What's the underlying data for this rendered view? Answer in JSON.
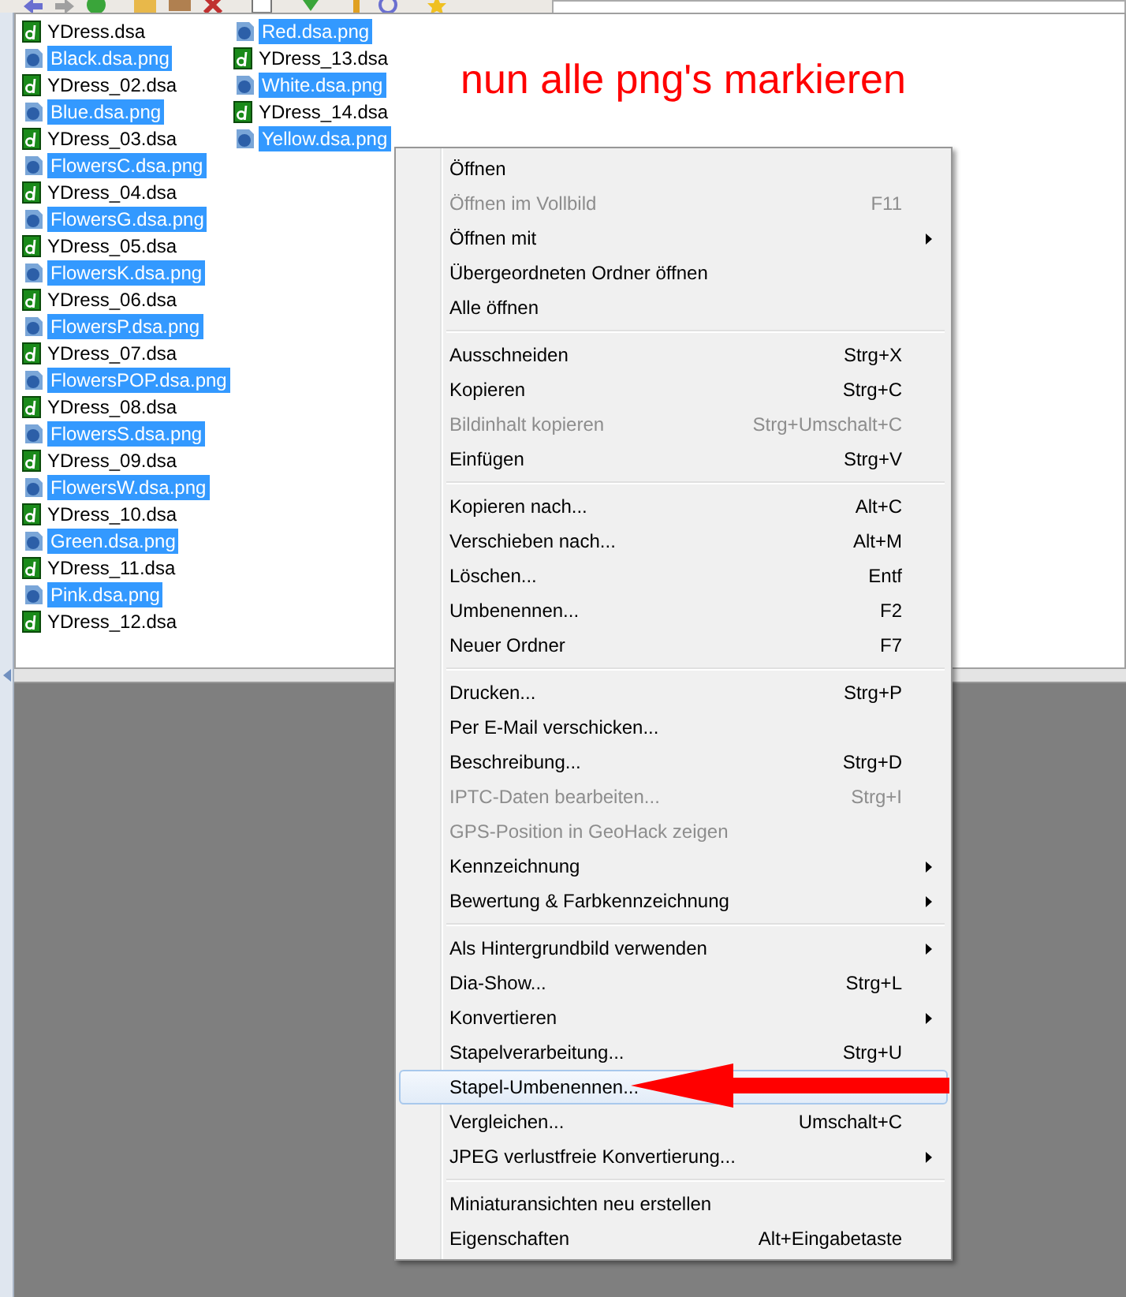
{
  "files": [
    {
      "name": "YDress.dsa",
      "kind": "dsa",
      "selected": false
    },
    {
      "name": "Black.dsa.png",
      "kind": "png",
      "selected": true
    },
    {
      "name": "YDress_02.dsa",
      "kind": "dsa",
      "selected": false
    },
    {
      "name": "Blue.dsa.png",
      "kind": "png",
      "selected": true
    },
    {
      "name": "YDress_03.dsa",
      "kind": "dsa",
      "selected": false
    },
    {
      "name": "FlowersC.dsa.png",
      "kind": "png",
      "selected": true
    },
    {
      "name": "YDress_04.dsa",
      "kind": "dsa",
      "selected": false
    },
    {
      "name": "FlowersG.dsa.png",
      "kind": "png",
      "selected": true
    },
    {
      "name": "YDress_05.dsa",
      "kind": "dsa",
      "selected": false
    },
    {
      "name": "FlowersK.dsa.png",
      "kind": "png",
      "selected": true
    },
    {
      "name": "YDress_06.dsa",
      "kind": "dsa",
      "selected": false
    },
    {
      "name": "FlowersP.dsa.png",
      "kind": "png",
      "selected": true
    },
    {
      "name": "YDress_07.dsa",
      "kind": "dsa",
      "selected": false
    },
    {
      "name": "FlowersPOP.dsa.png",
      "kind": "png",
      "selected": true
    },
    {
      "name": "YDress_08.dsa",
      "kind": "dsa",
      "selected": false
    },
    {
      "name": "FlowersS.dsa.png",
      "kind": "png",
      "selected": true
    },
    {
      "name": "YDress_09.dsa",
      "kind": "dsa",
      "selected": false
    },
    {
      "name": "FlowersW.dsa.png",
      "kind": "png",
      "selected": true
    },
    {
      "name": "YDress_10.dsa",
      "kind": "dsa",
      "selected": false
    },
    {
      "name": "Green.dsa.png",
      "kind": "png",
      "selected": true
    },
    {
      "name": "YDress_11.dsa",
      "kind": "dsa",
      "selected": false
    },
    {
      "name": "Pink.dsa.png",
      "kind": "png",
      "selected": true
    },
    {
      "name": "YDress_12.dsa",
      "kind": "dsa",
      "selected": false
    },
    {
      "name": "Red.dsa.png",
      "kind": "png",
      "selected": true
    },
    {
      "name": "YDress_13.dsa",
      "kind": "dsa",
      "selected": false
    },
    {
      "name": "White.dsa.png",
      "kind": "png",
      "selected": true
    },
    {
      "name": "YDress_14.dsa",
      "kind": "dsa",
      "selected": false
    },
    {
      "name": "Yellow.dsa.png",
      "kind": "png",
      "selected": true
    }
  ],
  "annotation": "nun alle png's markieren",
  "context_menu": {
    "groups": [
      [
        {
          "label": "Öffnen",
          "disabled": false,
          "submenu": false,
          "selected": false
        },
        {
          "label": "Öffnen im Vollbild",
          "shortcut": "F11",
          "disabled": true,
          "submenu": false,
          "selected": false
        },
        {
          "label": "Öffnen mit",
          "disabled": false,
          "submenu": true,
          "selected": false
        },
        {
          "label": "Übergeordneten Ordner öffnen",
          "disabled": false,
          "submenu": false,
          "selected": false
        },
        {
          "label": "Alle öffnen",
          "disabled": false,
          "submenu": false,
          "selected": false
        }
      ],
      [
        {
          "label": "Ausschneiden",
          "shortcut": "Strg+X",
          "disabled": false,
          "submenu": false,
          "selected": false
        },
        {
          "label": "Kopieren",
          "shortcut": "Strg+C",
          "disabled": false,
          "submenu": false,
          "selected": false
        },
        {
          "label": "Bildinhalt kopieren",
          "shortcut": "Strg+Umschalt+C",
          "disabled": true,
          "submenu": false,
          "selected": false
        },
        {
          "label": "Einfügen",
          "shortcut": "Strg+V",
          "disabled": false,
          "submenu": false,
          "selected": false
        }
      ],
      [
        {
          "label": "Kopieren nach...",
          "shortcut": "Alt+C",
          "disabled": false,
          "submenu": false,
          "selected": false
        },
        {
          "label": "Verschieben nach...",
          "shortcut": "Alt+M",
          "disabled": false,
          "submenu": false,
          "selected": false
        },
        {
          "label": "Löschen...",
          "shortcut": "Entf",
          "disabled": false,
          "submenu": false,
          "selected": false
        },
        {
          "label": "Umbenennen...",
          "shortcut": "F2",
          "disabled": false,
          "submenu": false,
          "selected": false
        },
        {
          "label": "Neuer Ordner",
          "shortcut": "F7",
          "disabled": false,
          "submenu": false,
          "selected": false
        }
      ],
      [
        {
          "label": "Drucken...",
          "shortcut": "Strg+P",
          "disabled": false,
          "submenu": false,
          "selected": false
        },
        {
          "label": "Per E-Mail verschicken...",
          "disabled": false,
          "submenu": false,
          "selected": false
        },
        {
          "label": "Beschreibung...",
          "shortcut": "Strg+D",
          "disabled": false,
          "submenu": false,
          "selected": false
        },
        {
          "label": "IPTC-Daten bearbeiten...",
          "shortcut": "Strg+I",
          "disabled": true,
          "submenu": false,
          "selected": false
        },
        {
          "label": "GPS-Position in GeoHack zeigen",
          "disabled": true,
          "submenu": false,
          "selected": false
        },
        {
          "label": "Kennzeichnung",
          "disabled": false,
          "submenu": true,
          "selected": false
        },
        {
          "label": "Bewertung & Farbkennzeichnung",
          "disabled": false,
          "submenu": true,
          "selected": false
        }
      ],
      [
        {
          "label": "Als Hintergrundbild verwenden",
          "disabled": false,
          "submenu": true,
          "selected": false
        },
        {
          "label": "Dia-Show...",
          "shortcut": "Strg+L",
          "disabled": false,
          "submenu": false,
          "selected": false
        },
        {
          "label": "Konvertieren",
          "disabled": false,
          "submenu": true,
          "selected": false
        },
        {
          "label": "Stapelverarbeitung...",
          "shortcut": "Strg+U",
          "disabled": false,
          "submenu": false,
          "selected": false
        },
        {
          "label": "Stapel-Umbenennen...",
          "disabled": false,
          "submenu": false,
          "selected": true
        },
        {
          "label": "Vergleichen...",
          "shortcut": "Umschalt+C",
          "disabled": false,
          "submenu": false,
          "selected": false
        },
        {
          "label": "JPEG verlustfreie Konvertierung...",
          "disabled": false,
          "submenu": true,
          "selected": false
        }
      ],
      [
        {
          "label": "Miniaturansichten neu erstellen",
          "disabled": false,
          "submenu": false,
          "selected": false
        },
        {
          "label": "Eigenschaften",
          "shortcut": "Alt+Eingabetaste",
          "disabled": false,
          "submenu": false,
          "selected": false
        }
      ]
    ]
  }
}
